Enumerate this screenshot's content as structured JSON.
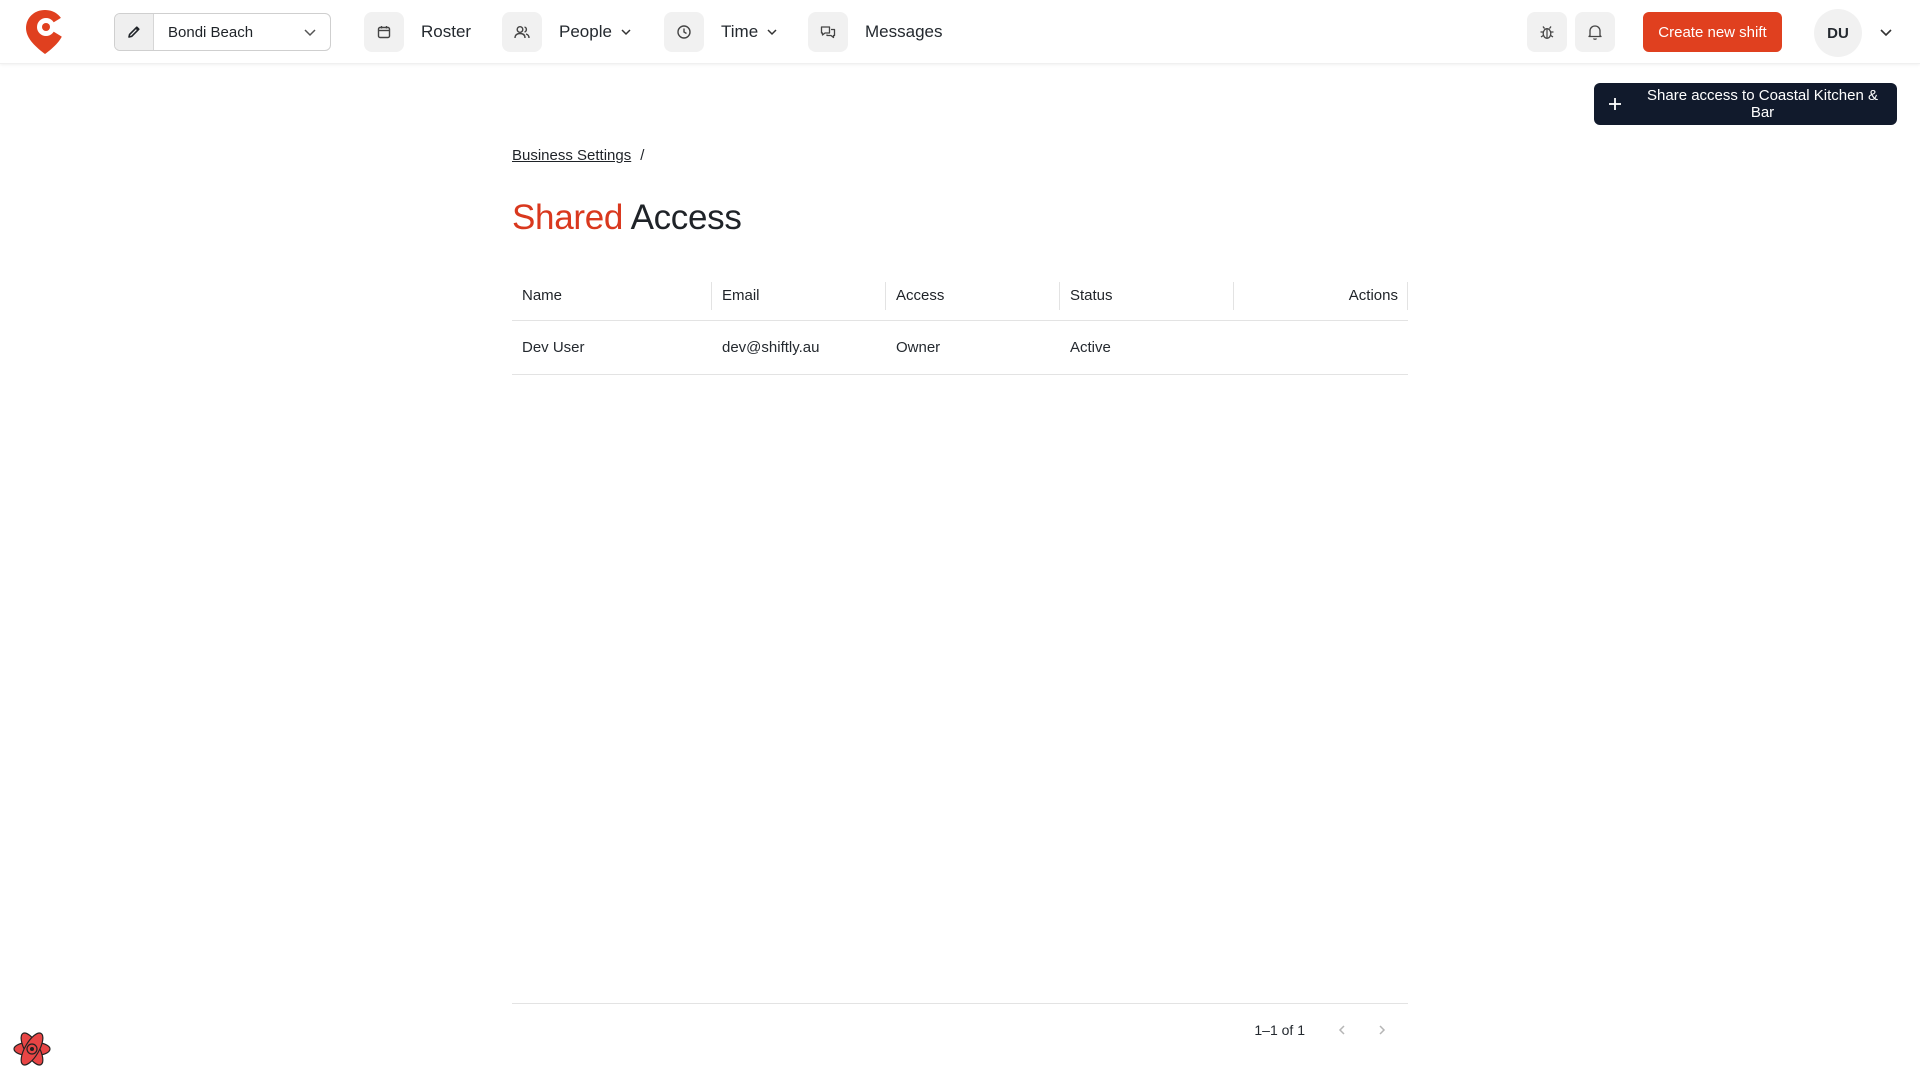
{
  "app": {
    "brand_color": "#e0401f",
    "logo_icon": "shiftly-logo-icon"
  },
  "topnav": {
    "location": {
      "label": "Bondi Beach",
      "icon": "pencil-icon"
    },
    "items": [
      {
        "label": "Roster",
        "icon": "calendar-icon",
        "has_dropdown": false
      },
      {
        "label": "People",
        "icon": "people-icon",
        "has_dropdown": true
      },
      {
        "label": "Time",
        "icon": "clock-icon",
        "has_dropdown": true
      },
      {
        "label": "Messages",
        "icon": "chat-icon",
        "has_dropdown": false
      }
    ],
    "debug_icon": "bug-icon",
    "notifications_icon": "bell-icon",
    "create_shift_label": "Create new shift",
    "avatar_initials": "DU"
  },
  "page": {
    "share_button_label": "Share access to Coastal Kitchen & Bar",
    "breadcrumb": {
      "parent": "Business Settings",
      "separator": "/"
    },
    "title": {
      "accent": "Shared",
      "rest": "Access",
      "accent_color": "#d9381e"
    }
  },
  "table": {
    "columns": [
      "Name",
      "Email",
      "Access",
      "Status",
      "Actions"
    ],
    "rows": [
      {
        "name": "Dev User",
        "email": "dev@shiftly.au",
        "access": "Owner",
        "status": "Active"
      }
    ]
  },
  "pagination": {
    "text": "1–1 of 1"
  },
  "devtools": {
    "icon": "react-devtools-icon"
  }
}
